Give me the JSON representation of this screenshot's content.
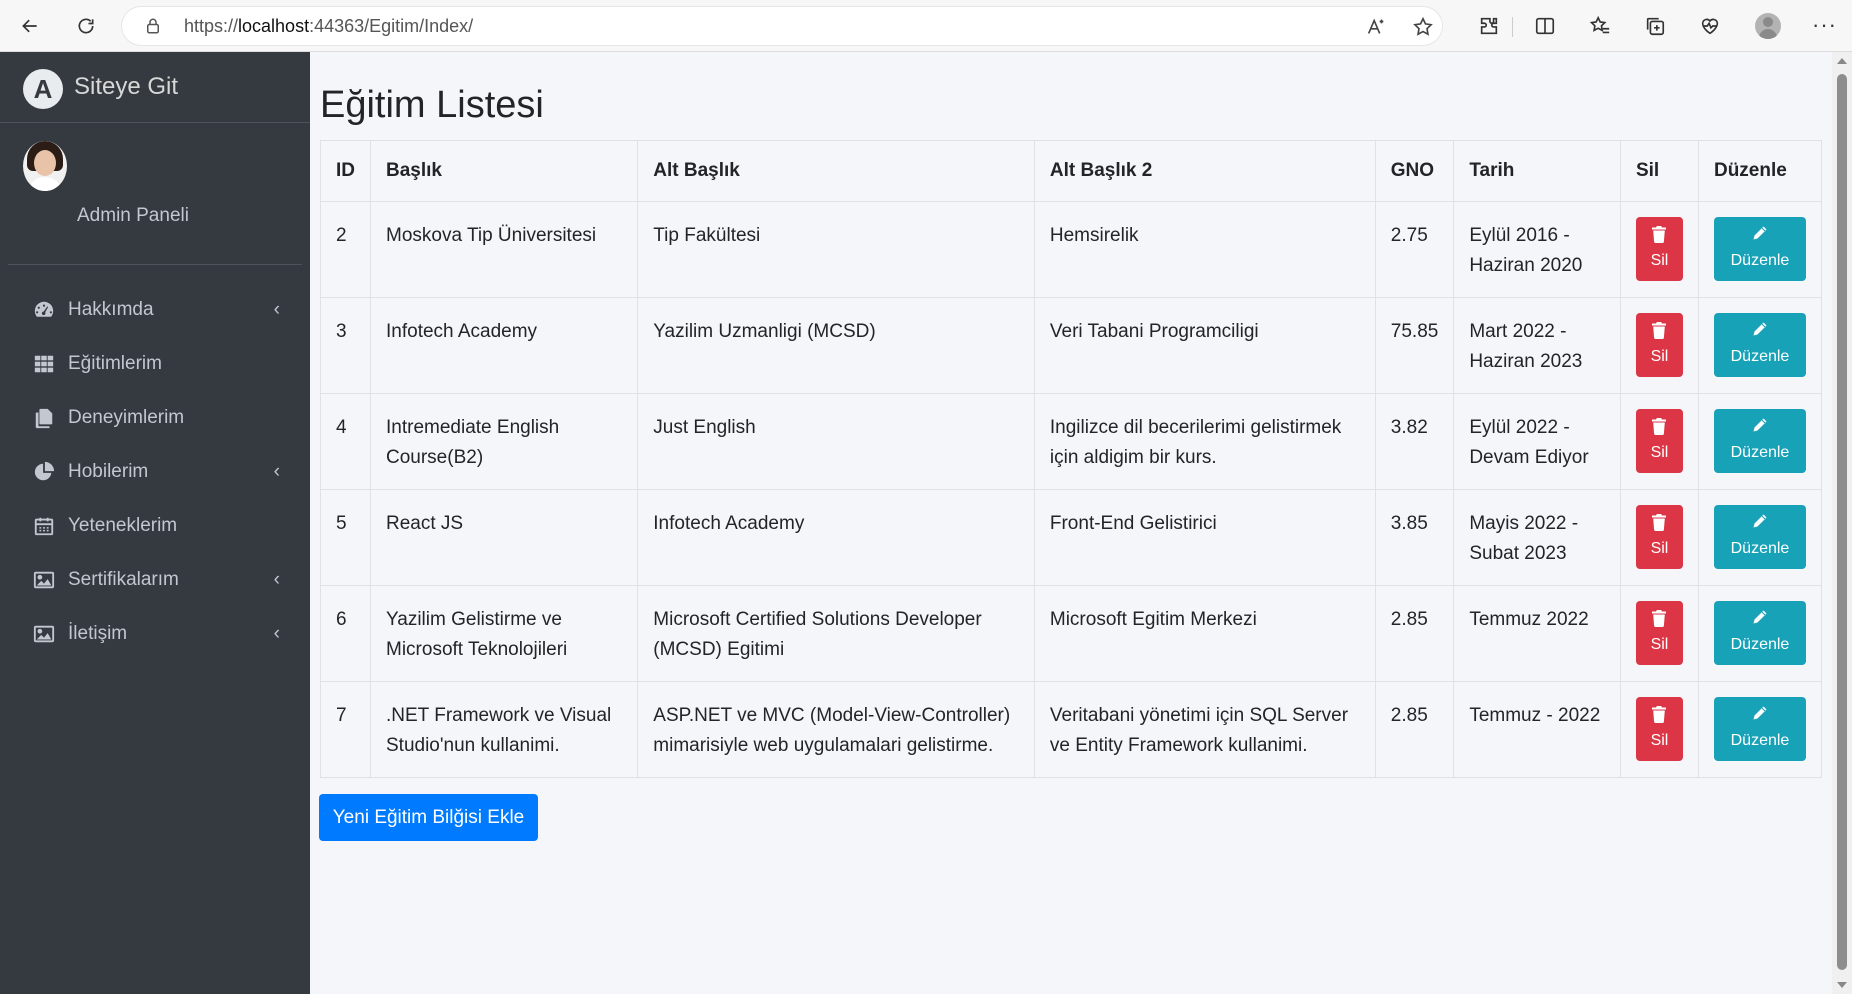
{
  "browser": {
    "url_scheme": "https://",
    "url_host": "localhost",
    "url_rest": ":44363/Egitim/Index/"
  },
  "sidebar": {
    "brand_text": "Siteye Git",
    "brand_logo": "A",
    "user_name": "Admin Paneli",
    "items": [
      {
        "label": "Hakkımda",
        "icon": "dashboard-icon",
        "has_chevron": true
      },
      {
        "label": "Eğitimlerim",
        "icon": "grid-icon",
        "has_chevron": false
      },
      {
        "label": "Deneyimlerim",
        "icon": "copy-icon",
        "has_chevron": false
      },
      {
        "label": "Hobilerim",
        "icon": "pie-chart-icon",
        "has_chevron": true
      },
      {
        "label": "Yeteneklerim",
        "icon": "calendar-icon",
        "has_chevron": false
      },
      {
        "label": "Sertifikalarım",
        "icon": "image-icon",
        "has_chevron": true
      },
      {
        "label": "İletişim",
        "icon": "image-icon",
        "has_chevron": true
      }
    ],
    "chevron": "‹"
  },
  "main": {
    "title": "Eğitim Listesi",
    "columns": [
      "ID",
      "Başlık",
      "Alt Başlık",
      "Alt Başlık 2",
      "GNO",
      "Tarih",
      "Sil",
      "Düzenle"
    ],
    "rows": [
      {
        "id": "2",
        "baslik": "Moskova Tip Üniversitesi",
        "alt_baslik": "Tip Fakültesi",
        "alt_baslik2": "Hemsirelik",
        "gno": "2.75",
        "tarih": "Eylül 2016 - Haziran 2020"
      },
      {
        "id": "3",
        "baslik": "Infotech Academy",
        "alt_baslik": "Yazilim Uzmanligi (MCSD)",
        "alt_baslik2": "Veri Tabani Programciligi",
        "gno": "75.85",
        "tarih": "Mart 2022 - Haziran 2023"
      },
      {
        "id": "4",
        "baslik": "Intremediate English Course(B2)",
        "alt_baslik": "Just English",
        "alt_baslik2": "Ingilizce dil becerilerimi gelistirmek için aldigim bir kurs.",
        "gno": "3.82",
        "tarih": "Eylül 2022 - Devam Ediyor"
      },
      {
        "id": "5",
        "baslik": "React JS",
        "alt_baslik": "Infotech Academy",
        "alt_baslik2": "Front-End Gelistirici",
        "gno": "3.85",
        "tarih": "Mayis 2022 - Subat 2023"
      },
      {
        "id": "6",
        "baslik": "Yazilim Gelistirme ve Microsoft Teknolojileri",
        "alt_baslik": "Microsoft Certified Solutions Developer (MCSD) Egitimi",
        "alt_baslik2": "Microsoft Egitim Merkezi",
        "gno": "2.85",
        "tarih": "Temmuz 2022"
      },
      {
        "id": "7",
        "baslik": ".NET Framework ve Visual Studio'nun kullanimi.",
        "alt_baslik": "ASP.NET ve MVC (Model-View-Controller) mimarisiyle web uygulamalari gelistirme.",
        "alt_baslik2": "Veritabani yönetimi için SQL Server ve Entity Framework kullanimi.",
        "gno": "2.85",
        "tarih": "Temmuz - 2022"
      }
    ],
    "delete_label": "Sil",
    "edit_label": "Düzenle",
    "add_button_label": "Yeni Eğitim Bilğisi Ekle"
  },
  "colors": {
    "sidebar_bg": "#343a40",
    "danger": "#dc3545",
    "info": "#17a2b8",
    "primary": "#007bff",
    "content_bg": "#f4f6f9"
  }
}
